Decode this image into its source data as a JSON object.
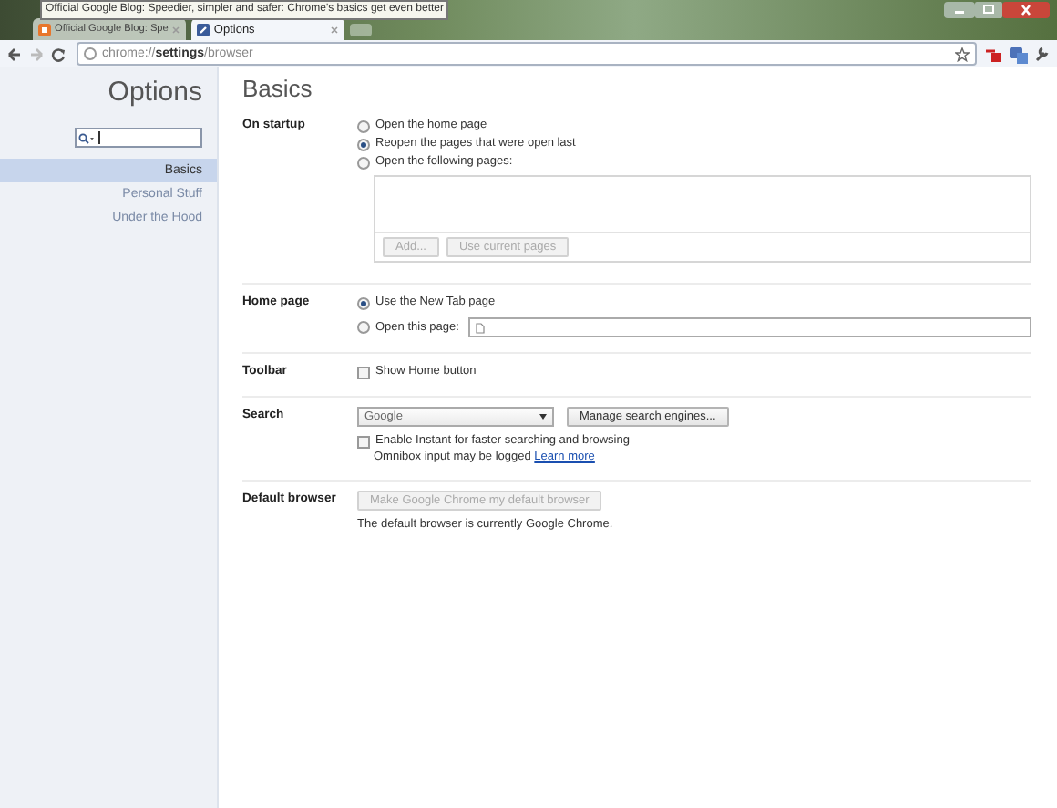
{
  "tooltip": "Official Google Blog: Speedier, simpler and safer: Chrome's basics get even better",
  "tabs": [
    {
      "label": "Official Google Blog: Spe",
      "selected": false
    },
    {
      "label": "Options",
      "selected": true
    }
  ],
  "address": "chrome://**settings**/browser",
  "sidebar": {
    "title": "Options",
    "items": [
      {
        "label": "Basics",
        "selected": true
      },
      {
        "label": "Personal Stuff",
        "selected": false
      },
      {
        "label": "Under the Hood",
        "selected": false
      }
    ]
  },
  "page": {
    "title": "Basics",
    "sections": [
      {
        "label": "On startup",
        "rows": [
          {
            "kind": "radio",
            "label": "Open the home page",
            "selected": false
          },
          {
            "kind": "radio",
            "label": "Reopen the pages that were open last",
            "selected": true
          },
          {
            "kind": "radio",
            "label": "Open the following pages:",
            "selected": false
          },
          {
            "kind": "pages_list",
            "buttons": [
              {
                "label": "Add...",
                "disabled": true
              },
              {
                "label": "Use current pages",
                "disabled": true
              }
            ]
          }
        ]
      },
      {
        "label": "Home page",
        "rows": [
          {
            "kind": "radio",
            "label": "Use the New Tab page",
            "selected": true
          },
          {
            "kind": "radio_field",
            "label": "Open this page:",
            "selected": false
          }
        ]
      },
      {
        "label": "Toolbar",
        "rows": [
          {
            "kind": "checkbox",
            "label": "Show Home button",
            "checked": false
          }
        ]
      },
      {
        "label": "Search",
        "rows": [
          {
            "kind": "select",
            "value": "Google",
            "button": {
              "label": "Manage search engines...",
              "disabled": false
            }
          },
          {
            "kind": "checkbox",
            "label": "Enable Instant for faster searching and browsing",
            "checked": false,
            "note": "Omnibox input may be logged",
            "link": "Learn more"
          }
        ]
      },
      {
        "label": "Default browser",
        "rows": [
          {
            "kind": "button",
            "label": "Make Google Chrome my default browser",
            "disabled": true
          },
          {
            "kind": "text",
            "text": "The default browser is currently Google Chrome."
          }
        ]
      }
    ]
  }
}
